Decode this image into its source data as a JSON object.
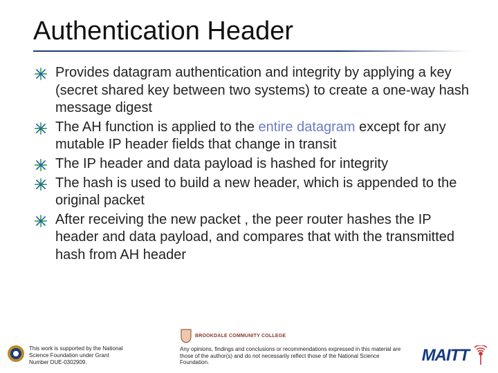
{
  "title": "Authentication Header",
  "bullets": [
    {
      "text": "Provides datagram authentication and integrity by applying a key (secret shared key between two systems) to create a one-way hash message digest"
    },
    {
      "pre": "The AH function is applied to the ",
      "emph": "entire datagram",
      "post": " except for any mutable IP header fields that change in transit"
    },
    {
      "text": "The IP header and data payload is hashed for integrity"
    },
    {
      "text": "The hash is used to build a new header, which is appended to the original packet"
    },
    {
      "text": "After receiving the new packet , the peer router hashes the IP header and data payload, and compares that with the transmitted hash from AH header"
    }
  ],
  "footer": {
    "nsf_support": "This work is supported by the National Science Foundation under Grant Number DUE-0302909.",
    "brookdale_label": "BROOKDALE COMMUNITY COLLEGE",
    "disclaimer": "Any opinions, findings and conclusions or recommendations expressed in this material are those of the author(s) and do not necessarily reflect those of the National Science Foundation.",
    "maitt": "MAITT"
  }
}
